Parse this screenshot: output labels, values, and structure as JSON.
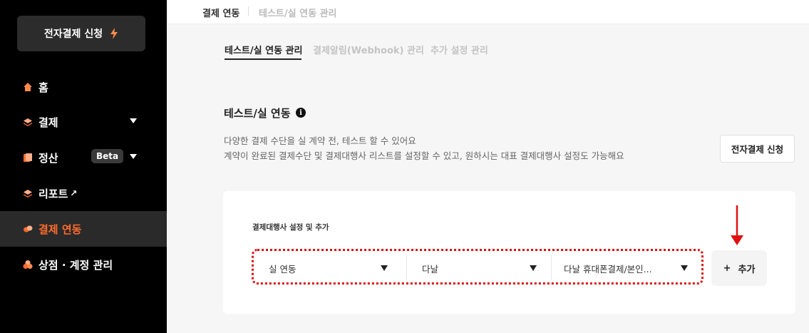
{
  "sidebar": {
    "apply_button": "전자결제 신청",
    "items": [
      {
        "label": "홈"
      },
      {
        "label": "결제"
      },
      {
        "label": "정산",
        "badge": "Beta"
      },
      {
        "label": "리포트",
        "ext": "↗"
      },
      {
        "label": "결제 연동"
      },
      {
        "label": "상점 · 계정 관리"
      }
    ]
  },
  "breadcrumb": {
    "current": "결제 연동",
    "sub": "테스트/실 연동 관리"
  },
  "tabs": [
    "테스트/실 연동 관리",
    "결제알림(Webhook) 관리",
    "추가 설정 관리"
  ],
  "section": {
    "title": "테스트/실 연동",
    "info_icon": "i",
    "desc1": "다양한 결제 수단을 실 계약 전, 테스트 할 수 있어요",
    "desc2": "계약이 완료된 결제수단 및 결제대행사 리스트를 설정할 수 있고, 원하시는 대표 결제대행사 설정도 가능해요",
    "apply_button": "전자결제 신청"
  },
  "card": {
    "label": "결제대행사 설정 및 추가",
    "select_mode": "실 연동",
    "select_pg": "다날",
    "select_method": "다날 휴대폰결제/본인...",
    "add_label": "추가",
    "add_icon": "+"
  },
  "colors": {
    "accent": "#ff6b2c",
    "annotation": "#e01010"
  }
}
